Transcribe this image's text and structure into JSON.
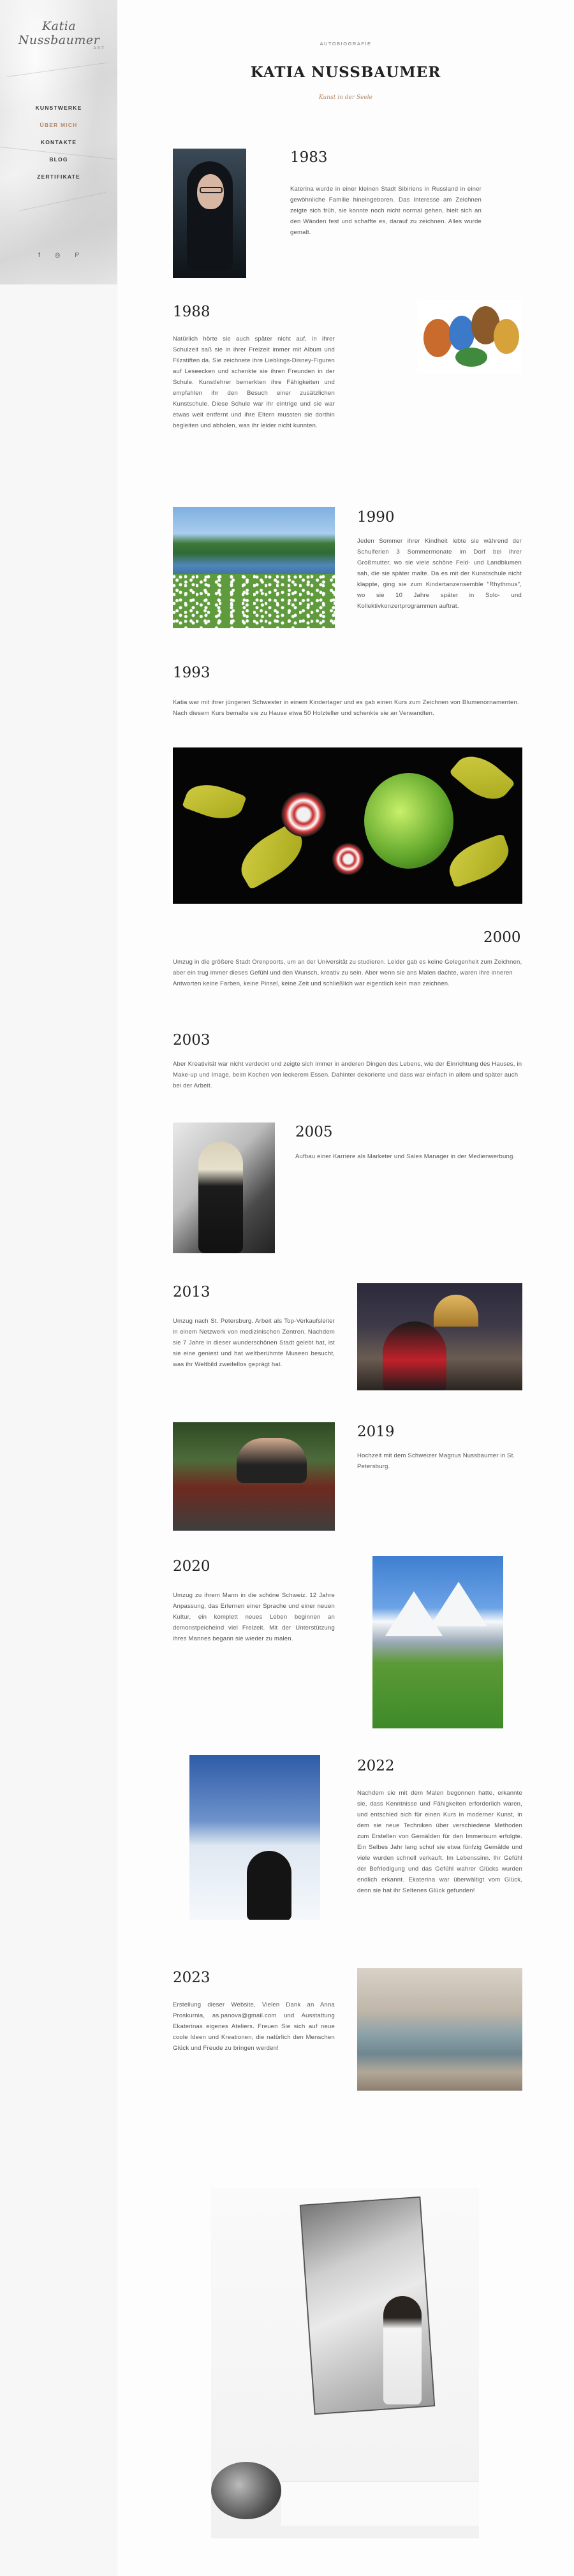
{
  "sidebar": {
    "logo_text": "Katia Nussbaumer",
    "logo_small": "ART",
    "nav": [
      {
        "label": "KUNSTWERKE",
        "active": false
      },
      {
        "label": "ÜBER MICH",
        "active": true
      },
      {
        "label": "KONTAKTE",
        "active": false
      },
      {
        "label": "BLOG",
        "active": false
      },
      {
        "label": "ZERTIFIKATE",
        "active": false
      }
    ],
    "social_icons": [
      "facebook-icon",
      "instagram-icon",
      "pinterest-icon"
    ],
    "social_glyphs": [
      "f",
      "◎",
      "P"
    ]
  },
  "header": {
    "kicker": "AUTOBIOGRAFIE",
    "title": "KATIA NUSSBAUMER",
    "subtitle": "Kunst in der Seele"
  },
  "timeline": [
    {
      "year": "1983",
      "text": "Katerina wurde in einer kleinen Stadt Sibiriens in Russland in einer gewöhnliche Familie hineingeboren. Das Interesse am Zeichnen zeigte sich früh, sie konnte noch nicht normal gehen, hielt sich an den Wänden fest und schaffte es, darauf zu zeichnen. Alles wurde gemalt."
    },
    {
      "year": "1988",
      "text": "Natürlich hörte sie auch später nicht auf, in ihrer Schulzeit saß sie in ihrer Freizeit immer mit Album und Filzstiften da. Sie zeichnete ihre Lieblings-Disney-Figuren auf Leseecken und schenkte sie ihren Freunden in der Schule. Kunstlehrer bemerkten ihre Fähigkeiten und empfahlen ihr den Besuch einer zusätzlichen Kunstschule. Diese Schule war ihr eintrige und sie war etwas weit entfernt und ihre Eltern mussten sie dorthin begleiten und abholen, was ihr leider nicht kunnten."
    },
    {
      "year": "1990",
      "text": "Jeden Sommer ihrer Kindheit lebte sie während der Schulferien 3 Sommermonate im Dorf bei ihrer Großmutter, wo sie viele schöne Feld- und Landblumen sah, die sie später malte. Da es mit der Kunstschule nicht klappte, ging sie zum Kindertanzensemble \"Rhythmus\", wo sie 10 Jahre später in Solo- und Kollektivkonzertprogrammen auftrat."
    },
    {
      "year": "1993",
      "text": "Katia war mit ihrer jüngeren Schwester in einem Kindertager und es gab einen Kurs zum Zeichnen von Blumenornamenten. Nach diesem Kurs bemalte sie zu Hause etwa 50 Holzteller und schenkte sie an Verwandten."
    },
    {
      "year": "2000",
      "text": "Umzug in die größere Stadt Orenpoorts, um an der Universität zu studieren. Leider gab es keine Gelegenheit zum Zeichnen, aber ein trug immer dieses Gefühl und den Wunsch, kreativ zu sein. Aber wenn sie ans Malen dachte, waren ihre inneren Antworten keine Farben, keine Pinsel, keine Zeit und schließlich war eigentlich kein man zeichnen."
    },
    {
      "year": "2003",
      "text": "Aber Kreativität war nicht verdeckt und zeigte sich immer in anderen Dingen des Lebens, wie der Einrichtung des Hauses, in Make-up und Image, beim Kochen von leckerem Essen. Dahinter dekorierte und dass war einfach in allem und später auch bei der Arbeit."
    },
    {
      "year": "2005",
      "text": "Aufbau einer Karriere als Marketer und Sales Manager in der Medienwerbung."
    },
    {
      "year": "2013",
      "text": "Umzug nach St. Petersburg. Arbeit als Top-Verkaufsleiter in einem Netzwerk von medizinischen Zentren. Nachdem sie 7 Jahre in dieser wunderschönen Stadt gelebt hat, ist sie eine geniest und hat weltberühmte Museen besucht, was ihr Weltbild zweifellos geprägt hat."
    },
    {
      "year": "2019",
      "text": "Hochzeit mit dem Schweizer Magnus Nussbaumer in St. Petersburg."
    },
    {
      "year": "2020",
      "text": "Umzug zu ihrem Mann in die schöne Schweiz. 12 Jahre Anpassung, das Erlernen einer Sprache und einer neuen Kultur, ein komplett neues Leben beginnen an demonstpeicheind viel Freizeit. Mit der Unterstützung ihres Mannes begann sie wieder zu malen."
    },
    {
      "year": "2022",
      "text": "Nachdem sie mit dem Malen begonnen hatte, erkannte sie, dass Kenntnisse und Fähigkeiten erforderlich waren, und entschied sich für einen Kurs in moderner Kunst, in dem sie neue Techniken über verschiedene Methoden zum Erstellen von Gemälden für den Immerisum erfolgte. Ein Selbes Jahr lang schuf sie etwa fünfzig Gemälde und viele wurden schnell verkauft. Im Lebenssinn. Ihr Gefühl der Befriedigung und das Gefühl wahrer Glücks wurden endlich erkannt. Ekaterina war überwältigt vom Glück, denn sie hat ihr Seltenes Glück gefunden!"
    },
    {
      "year": "2023",
      "text": "Erstellung dieser Website, Vielen Dank an Anna Proskurnia, as.panova@gmail.com und Ausstattung Ekaterinas eigenes Ateliers. Freuen Sie sich auf neue coole Ideen und Kreationen, die natürlich den Menschen Glück und Freude zu bringen werden!"
    }
  ],
  "images": [
    "portrait-photo",
    "cartoon-illustration",
    "lake-landscape-photo",
    "folk-flower-painting",
    "bw-portrait-photo",
    "st-petersburg-couple-photo",
    "wedding-car-photo",
    "swiss-alps-photo",
    "snow-mountain-photo",
    "sea-painting",
    "installation-photo"
  ]
}
